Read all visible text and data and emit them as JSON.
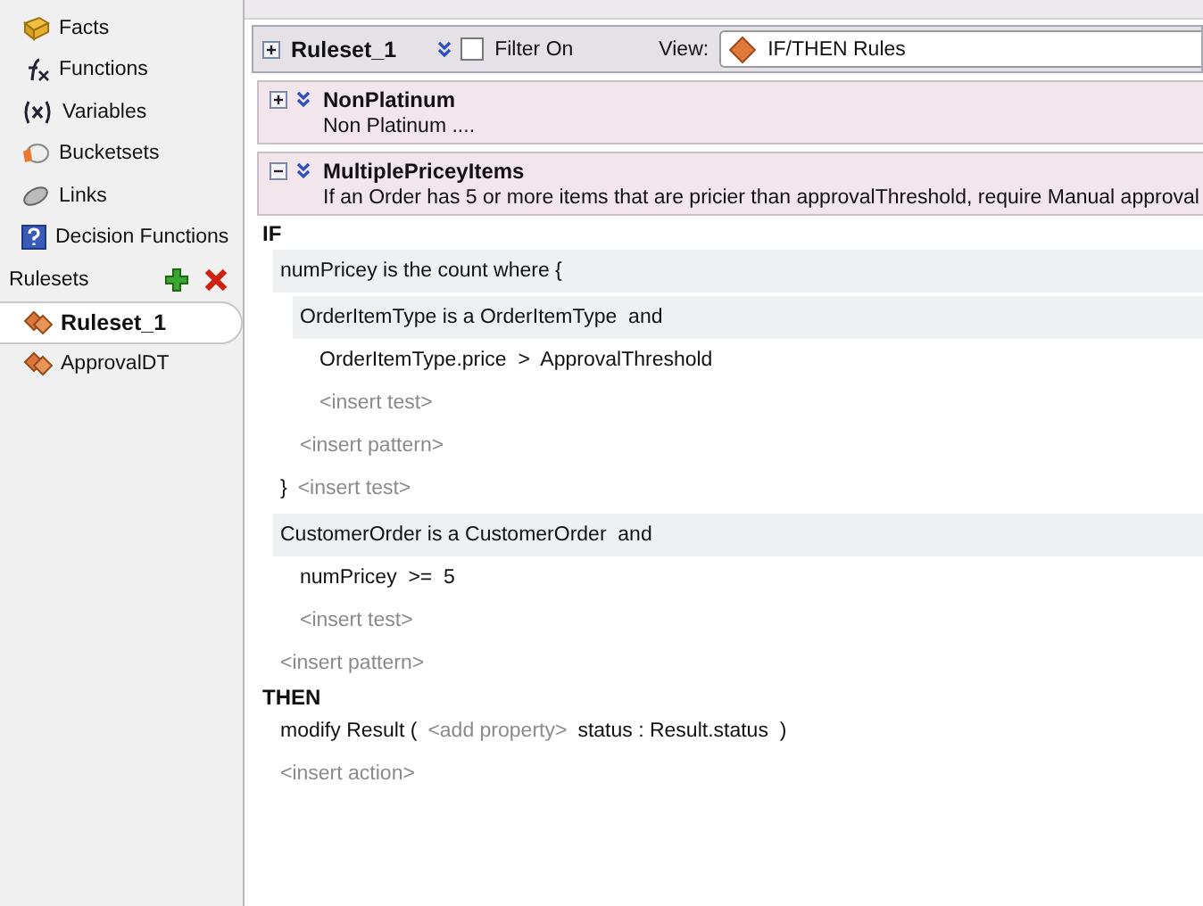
{
  "sidebar": {
    "items": [
      {
        "kind": "facts",
        "label": "Facts"
      },
      {
        "kind": "functions",
        "label": "Functions"
      },
      {
        "kind": "variables",
        "label": "Variables"
      },
      {
        "kind": "bucketsets",
        "label": "Bucketsets"
      },
      {
        "kind": "links",
        "label": "Links"
      },
      {
        "kind": "decision_functions",
        "label": "Decision Functions"
      }
    ],
    "rulesets_label": "Rulesets",
    "rulesets": [
      {
        "label": "Ruleset_1",
        "selected": true
      },
      {
        "label": "ApprovalDT",
        "selected": false
      }
    ]
  },
  "ruleset_header": {
    "expanded": false,
    "name": "Ruleset_1",
    "filter_checked": false,
    "filter_label": "Filter On",
    "view_label": "View:",
    "view_value": "IF/THEN Rules"
  },
  "rules": [
    {
      "name": "NonPlatinum",
      "description": "Non Platinum ....",
      "expanded": false
    },
    {
      "name": "MultiplePriceyItems",
      "description": "If an Order has 5 or more items that are pricier than approvalThreshold, require Manual approval",
      "expanded": true
    }
  ],
  "if_label": "IF",
  "if_lines": [
    {
      "kind": "pattern",
      "text": "numPricey is the count where {",
      "children": [
        {
          "kind": "pattern",
          "text": "OrderItemType is a OrderItemType  and",
          "children": [
            {
              "kind": "test",
              "text": "OrderItemType.price  >  ApprovalThreshold"
            },
            {
              "kind": "placeholder",
              "text": "<insert test>"
            }
          ]
        },
        {
          "kind": "placeholder",
          "text": "<insert pattern>"
        }
      ]
    },
    {
      "kind": "close",
      "text": "}",
      "placeholder": "<insert test>"
    },
    {
      "kind": "pattern",
      "text": "CustomerOrder is a CustomerOrder  and",
      "children": [
        {
          "kind": "test",
          "text": "numPricey  >=  5"
        },
        {
          "kind": "placeholder",
          "text": "<insert test>"
        }
      ]
    },
    {
      "kind": "placeholder",
      "text": "<insert pattern>"
    }
  ],
  "then_label": "THEN",
  "then_lines": [
    {
      "kind": "action",
      "text": "modify Result (",
      "placeholder": "<add property>",
      "rest": "status : Result.status  )"
    },
    {
      "kind": "placeholder",
      "text": "<insert action>"
    }
  ]
}
